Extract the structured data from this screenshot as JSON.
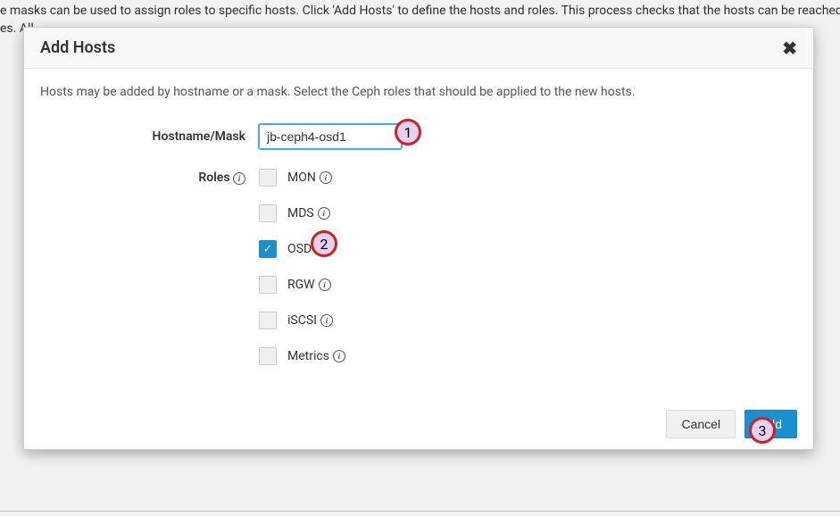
{
  "bg": {
    "line1": "e masks can be used to assign roles to specific hosts. Click 'Add Hosts' to define the hosts and roles. This process checks that the hosts can be reached, and the roles requ",
    "line2": "es. All"
  },
  "modal": {
    "title": "Add Hosts",
    "help_text": "Hosts may be added by hostname or a mask. Select the Ceph roles that should be applied to the new hosts.",
    "close_title": "Close"
  },
  "form": {
    "hostname_label": "Hostname/Mask",
    "hostname_value": "jb-ceph4-osd1",
    "roles_label": "Roles"
  },
  "roles": {
    "mon": {
      "label": "MON",
      "checked": false
    },
    "mds": {
      "label": "MDS",
      "checked": false
    },
    "osd": {
      "label": "OSD",
      "checked": true
    },
    "rgw": {
      "label": "RGW",
      "checked": false
    },
    "iscsi": {
      "label": "iSCSI",
      "checked": false
    },
    "metrics": {
      "label": "Metrics",
      "checked": false
    }
  },
  "footer": {
    "cancel": "Cancel",
    "add": "Add"
  },
  "callouts": {
    "c1": "1",
    "c2": "2",
    "c3": "3"
  }
}
